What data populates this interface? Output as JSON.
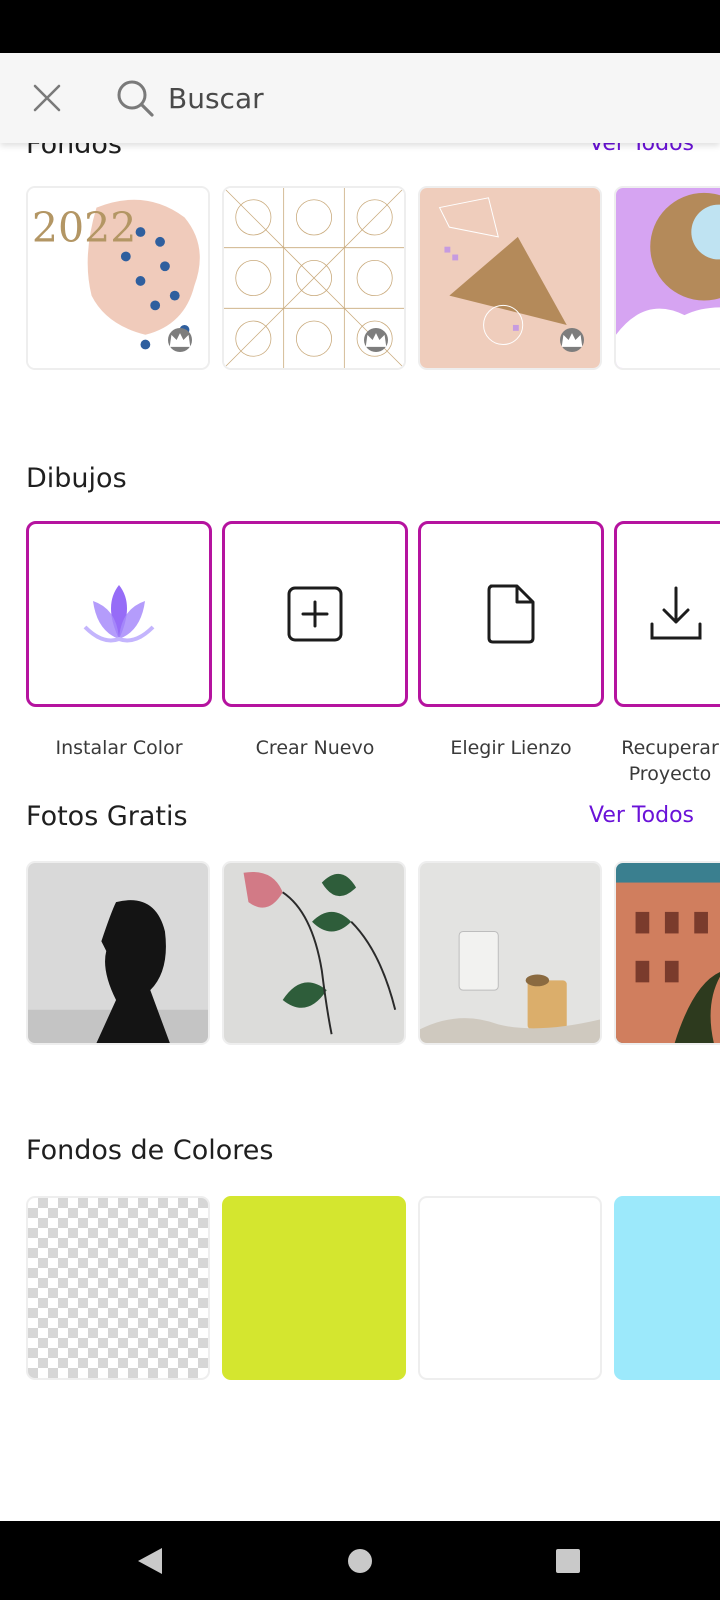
{
  "search": {
    "placeholder": "Buscar"
  },
  "sections": {
    "fondos": {
      "title": "Fondos",
      "see_all": "Ver Todos"
    },
    "dibujos": {
      "title": "Dibujos",
      "items": [
        {
          "label": "Instalar Color",
          "icon": "lotus-icon"
        },
        {
          "label": "Crear Nuevo",
          "icon": "add-square-icon"
        },
        {
          "label": "Elegir Lienzo",
          "icon": "document-icon"
        },
        {
          "label": "Recuperar Proyecto",
          "icon": "download-icon"
        }
      ]
    },
    "fotos": {
      "title": "Fotos Gratis",
      "see_all": "Ver Todos"
    },
    "colores": {
      "title": "Fondos de Colores",
      "swatches": [
        "transparent",
        "#d4e62f",
        "#ffffff",
        "#9ce9fb"
      ]
    }
  },
  "colors": {
    "accent": "#6a12d8",
    "tile_border": "#b5139f",
    "lotus": "#8b5cf6"
  }
}
